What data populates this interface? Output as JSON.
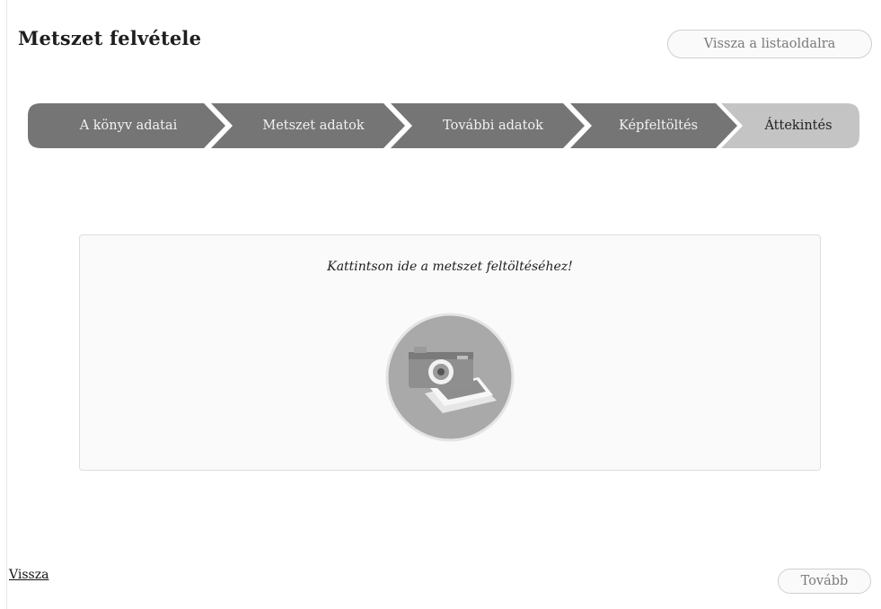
{
  "header": {
    "title": "Metszet felvétele",
    "back_to_list_label": "Vissza a listaoldalra"
  },
  "wizard": {
    "steps": [
      {
        "label": "A könyv adatai",
        "state": "done"
      },
      {
        "label": "Metszet adatok",
        "state": "done"
      },
      {
        "label": "További adatok",
        "state": "done"
      },
      {
        "label": "Képfeltöltés",
        "state": "done"
      },
      {
        "label": "Áttekintés",
        "state": "current"
      }
    ],
    "colors": {
      "done": "#757575",
      "current": "#c4c4c4",
      "separator": "#ffffff"
    }
  },
  "upload": {
    "hint": "Kattintson ide a metszet feltöltéséhez!",
    "icon": "camera-photo-icon"
  },
  "footer": {
    "back_label": "Vissza",
    "next_label": "Tovább"
  }
}
